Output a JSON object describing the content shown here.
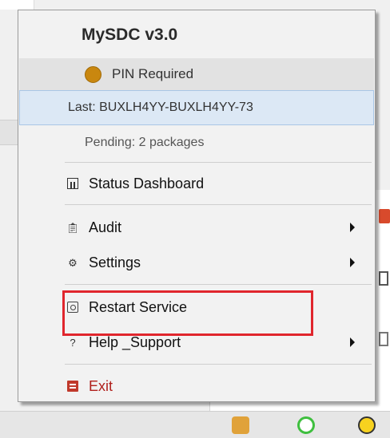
{
  "menu": {
    "title": "MySDC  v3.0",
    "pin_status": "PIN Required",
    "last_label": "Last: BUXLH4YY-BUXLH4YY-73",
    "pending_label": "Pending: 2 packages",
    "items": [
      {
        "label": "Status Dashboard",
        "icon": "chart-icon",
        "has_submenu": false
      },
      {
        "label": "Audit",
        "icon": "clipboard-icon",
        "has_submenu": true
      },
      {
        "label": "Settings",
        "icon": "gear-icon",
        "has_submenu": true
      },
      {
        "label": "Restart Service",
        "icon": "restart-icon",
        "has_submenu": false,
        "highlighted": true
      },
      {
        "label": "Help _Support",
        "icon": "help-icon",
        "has_submenu": true
      },
      {
        "label": "Exit",
        "icon": "exit-icon",
        "has_submenu": false
      }
    ]
  },
  "colors": {
    "pin_dot": "#c9870f",
    "last_row_bg": "#dce8f5",
    "highlight_border": "#e0262d",
    "exit_text": "#b0201c"
  }
}
